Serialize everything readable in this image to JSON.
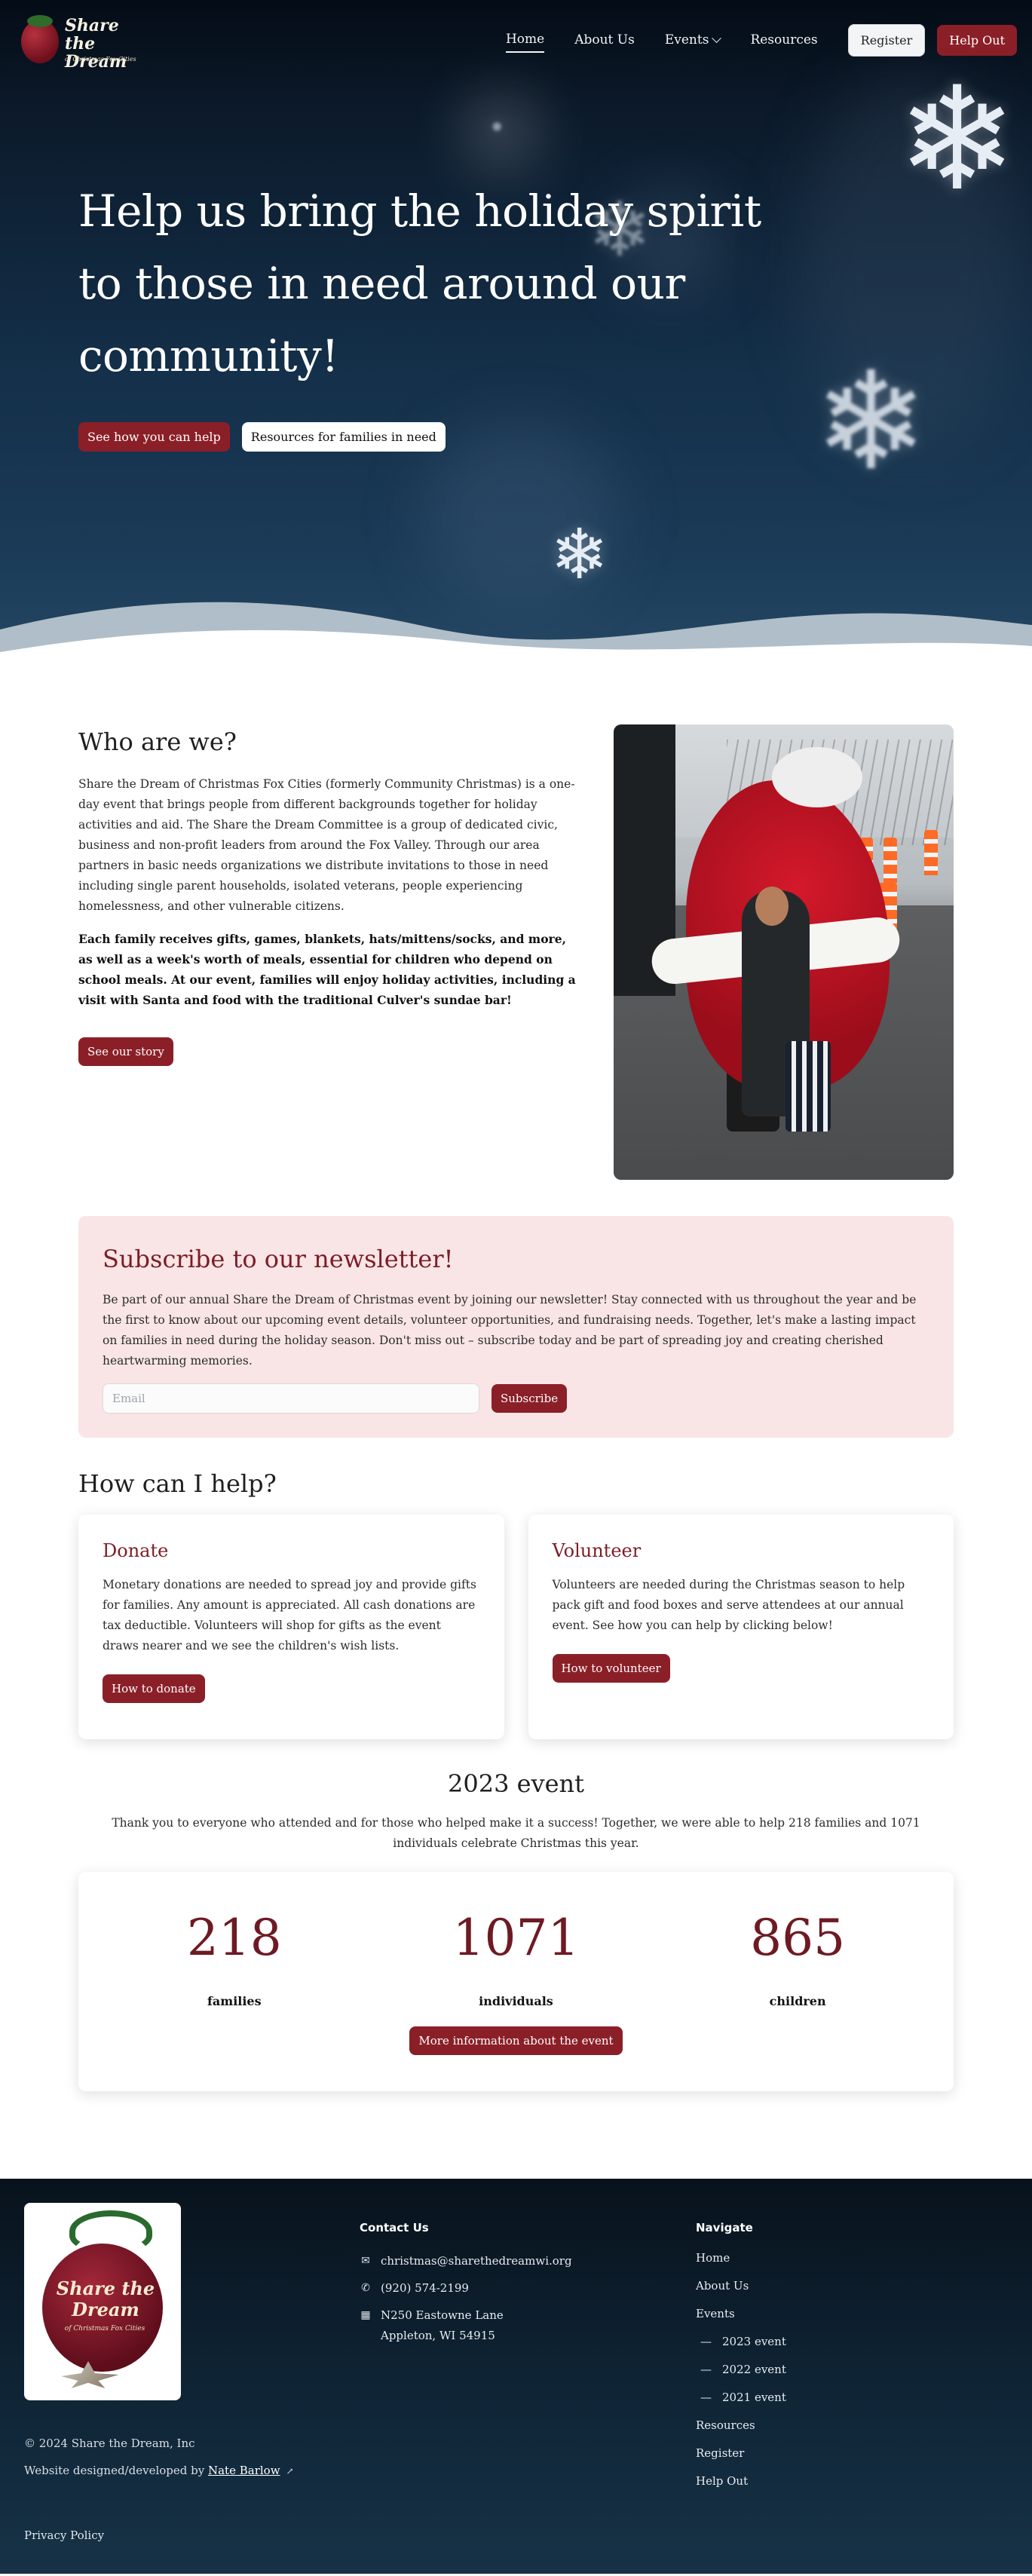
{
  "nav": {
    "logo_title": "Share the Dream",
    "logo_sub": "of Christmas Fox Cities",
    "items": [
      "Home",
      "About Us",
      "Events",
      "Resources"
    ],
    "register": "Register",
    "help_out": "Help Out"
  },
  "hero": {
    "heading": "Help us bring the holiday spirit to those in need around our community!",
    "primary_cta": "See how you can help",
    "secondary_cta": "Resources for families in need"
  },
  "who": {
    "title": "Who are we?",
    "para1": "Share the Dream of Christmas Fox Cities (formerly Community Christmas) is a one-day event that brings people from different backgrounds together for holiday activities and aid. The Share the Dream Committee is a group of dedicated civic, business and non-profit leaders from around the Fox Valley. Through our area partners in basic needs organizations we distribute invitations to those in need including single parent households, isolated veterans, people experiencing homelessness, and other vulnerable citizens.",
    "para2": "Each family receives gifts, games, blankets, hats/mittens/socks, and more, as well as a week's worth of meals, essential for children who depend on school meals. At our event, families will enjoy holiday activities, including a visit with Santa and food with the traditional Culver's sundae bar!",
    "cta": "See our story"
  },
  "newsletter": {
    "title": "Subscribe to our newsletter!",
    "text": "Be part of our annual Share the Dream of Christmas event by joining our newsletter! Stay connected with us throughout the year and be the first to know about our upcoming event details, volunteer opportunities, and fundraising needs. Together, let's make a lasting impact on families in need during the holiday season. Don't miss out – subscribe today and be part of spreading joy and creating cherished heartwarming memories.",
    "email_placeholder": "Email",
    "email_value": "",
    "subscribe": "Subscribe"
  },
  "help": {
    "title": "How can I help?",
    "donate": {
      "title": "Donate",
      "text": "Monetary donations are needed to spread joy and provide gifts for families. Any amount is appreciated. All cash donations are tax deductible. Volunteers will shop for gifts as the event draws nearer and we see the children's wish lists.",
      "cta": "How to donate"
    },
    "volunteer": {
      "title": "Volunteer",
      "text": "Volunteers are needed during the Christmas season to help pack gift and food boxes and serve attendees at our annual event. See how you can help by clicking below!",
      "cta": "How to volunteer"
    }
  },
  "event": {
    "title": "2023 event",
    "text": "Thank you to everyone who attended and for those who helped make it a success! Together, we were able to help 218 families and 1071 individuals celebrate Christmas this year.",
    "stats": [
      {
        "value": "218",
        "label": "families"
      },
      {
        "value": "1071",
        "label": "individuals"
      },
      {
        "value": "865",
        "label": "children"
      }
    ],
    "cta": "More information about the event"
  },
  "footer": {
    "logo_title": "Share the Dream",
    "logo_sub": "of Christmas Fox Cities",
    "copyright": "© 2024 Share the Dream, Inc",
    "designed_prefix": "Website designed/developed by",
    "designer": "Nate Barlow",
    "privacy": "Privacy Policy",
    "contact_title": "Contact Us",
    "email": "christmas@sharethedreamwi.org",
    "phone": "(920) 574-2199",
    "address_line1": "N250 Eastowne Lane",
    "address_line2": "Appleton, WI 54915",
    "nav_title": "Navigate",
    "nav_items": [
      "Home",
      "About Us",
      "Events",
      "2023 event",
      "2022 event",
      "2021 event",
      "Resources",
      "Register",
      "Help Out"
    ]
  },
  "colors": {
    "brand_red": "#8b1f28",
    "stat_red": "#6e1a24",
    "hero_navy": "#14304a",
    "newsletter_bg": "#f9e5e5"
  },
  "icons": [
    "snowflake-icon",
    "chevron-down-icon",
    "mail-icon",
    "phone-icon",
    "building-icon",
    "external-link-icon"
  ]
}
